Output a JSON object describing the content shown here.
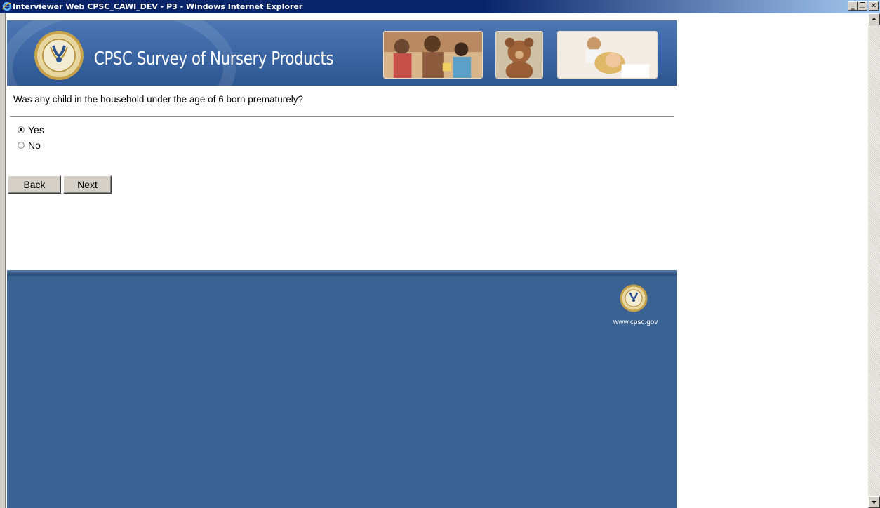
{
  "window": {
    "title": "Interviewer Web CPSC_CAWI_DEV - P3 - Windows Internet Explorer",
    "minimize": "_",
    "restore": "❐",
    "close": "✕"
  },
  "banner": {
    "title": "CPSC Survey of Nursery Products"
  },
  "question": {
    "text": "Was any child in the household under the age of 6 born prematurely?",
    "options": [
      {
        "label": "Yes",
        "selected": true
      },
      {
        "label": "No",
        "selected": false
      }
    ]
  },
  "buttons": {
    "back": "Back",
    "next": "Next"
  },
  "footer": {
    "site": "www.cpsc.gov"
  },
  "colors": {
    "titlebar": "#0a246a",
    "banner": "#3a65a2",
    "footer": "#3a6293"
  }
}
